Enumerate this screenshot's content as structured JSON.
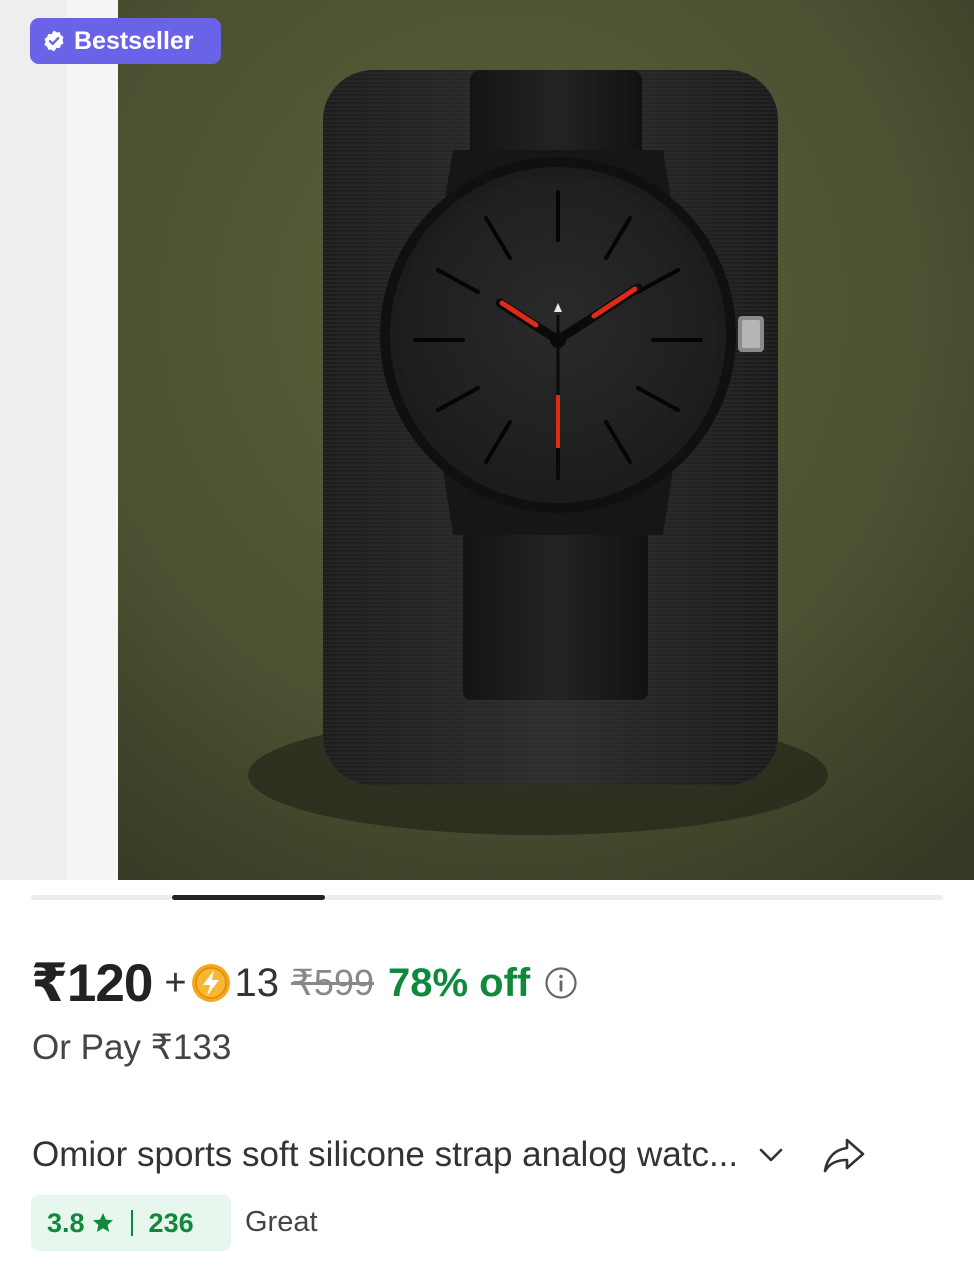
{
  "badge": {
    "label": "Bestseller",
    "color": "#6a63e8"
  },
  "gallery": {
    "image_alt": "black analog watch with red hands on a dark fabric pillow"
  },
  "price": {
    "current": "₹120",
    "plus": "+",
    "coins": "13",
    "mrp": "₹599",
    "discount": "78% off",
    "or_pay": "Or Pay ₹133",
    "discount_color": "#0f8a3c"
  },
  "product": {
    "title": "Omior sports soft silicone strap analog watc..."
  },
  "rating": {
    "score": "3.8",
    "count": "236",
    "label": "Great",
    "color": "#0f8a3c"
  },
  "icons": [
    "verified-icon",
    "coin-icon",
    "info-icon",
    "chevron-down-icon",
    "share-icon",
    "star-icon"
  ]
}
